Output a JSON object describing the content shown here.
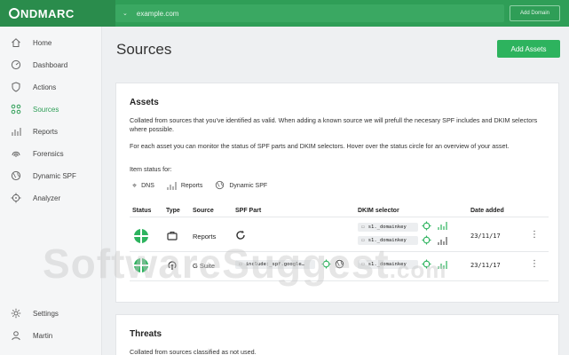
{
  "app": {
    "logo_text": "NDMARC"
  },
  "topbar": {
    "domain_value": "example.com",
    "add_domain_label": "Add Domain"
  },
  "sidebar": {
    "items": [
      {
        "label": "Home",
        "icon": "home-icon"
      },
      {
        "label": "Dashboard",
        "icon": "dashboard-icon"
      },
      {
        "label": "Actions",
        "icon": "shield-icon"
      },
      {
        "label": "Sources",
        "icon": "sources-icon",
        "active": true
      },
      {
        "label": "Reports",
        "icon": "bar-chart-icon"
      },
      {
        "label": "Forensics",
        "icon": "fingerprint-icon"
      },
      {
        "label": "Dynamic SPF",
        "icon": "globe-icon"
      },
      {
        "label": "Analyzer",
        "icon": "crosshair-icon"
      }
    ],
    "bottom_items": [
      {
        "label": "Settings",
        "icon": "gear-icon"
      },
      {
        "label": "Martin",
        "icon": "user-icon"
      }
    ]
  },
  "main": {
    "title": "Sources",
    "add_sources_label": "Add Assets",
    "assets": {
      "heading": "Assets",
      "paragraph1": "Collated from sources that you've identified as valid. When adding a known source we will prefull the necesary SPF includes and DKIM selectors where possible.",
      "paragraph2": "For each asset you can monitor the status of SPF parts and DKIM selectors. Hover over the status circle for an overview of your asset.",
      "status_for_label": "Item status for:",
      "legend": [
        "DNS",
        "Reports",
        "Dynamic SPF"
      ],
      "columns": [
        "Status",
        "Type",
        "Source",
        "SPF Part",
        "DKIM selector",
        "Date added"
      ],
      "rows": [
        {
          "source": "Reports",
          "spf_part": "",
          "dkim": [
            "s1._domainkey",
            "s1._domainkey"
          ],
          "date": "23/11/17"
        },
        {
          "source": "G Suite",
          "spf_part": "include:_spf.google…",
          "dkim": [
            "s1._domainkey"
          ],
          "date": "23/11/17"
        }
      ]
    },
    "threats": {
      "heading": "Threats",
      "paragraph": "Collated from sources classified as not used."
    }
  },
  "watermark": {
    "text": "SoftwareSuggest",
    "suffix": ".com"
  },
  "colors": {
    "brand_green": "#2f9e57",
    "accent_green": "#2db35e"
  }
}
